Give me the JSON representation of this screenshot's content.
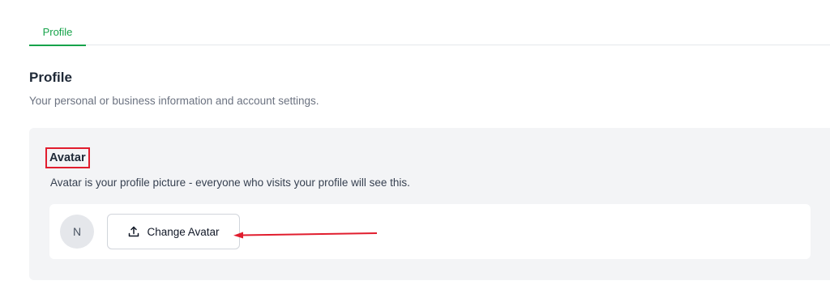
{
  "tabs": [
    {
      "label": "Profile",
      "active": true
    }
  ],
  "section": {
    "title": "Profile",
    "subtitle": "Your personal or business information and account settings."
  },
  "avatar": {
    "title": "Avatar",
    "description": "Avatar is your profile picture - everyone who visits your profile will see this.",
    "initial": "N",
    "change_button_label": "Change Avatar",
    "change_button_icon": "upload-icon"
  },
  "colors": {
    "accent": "#16a34a",
    "annotation": "#e11d2e",
    "card_bg": "#f3f4f6"
  }
}
